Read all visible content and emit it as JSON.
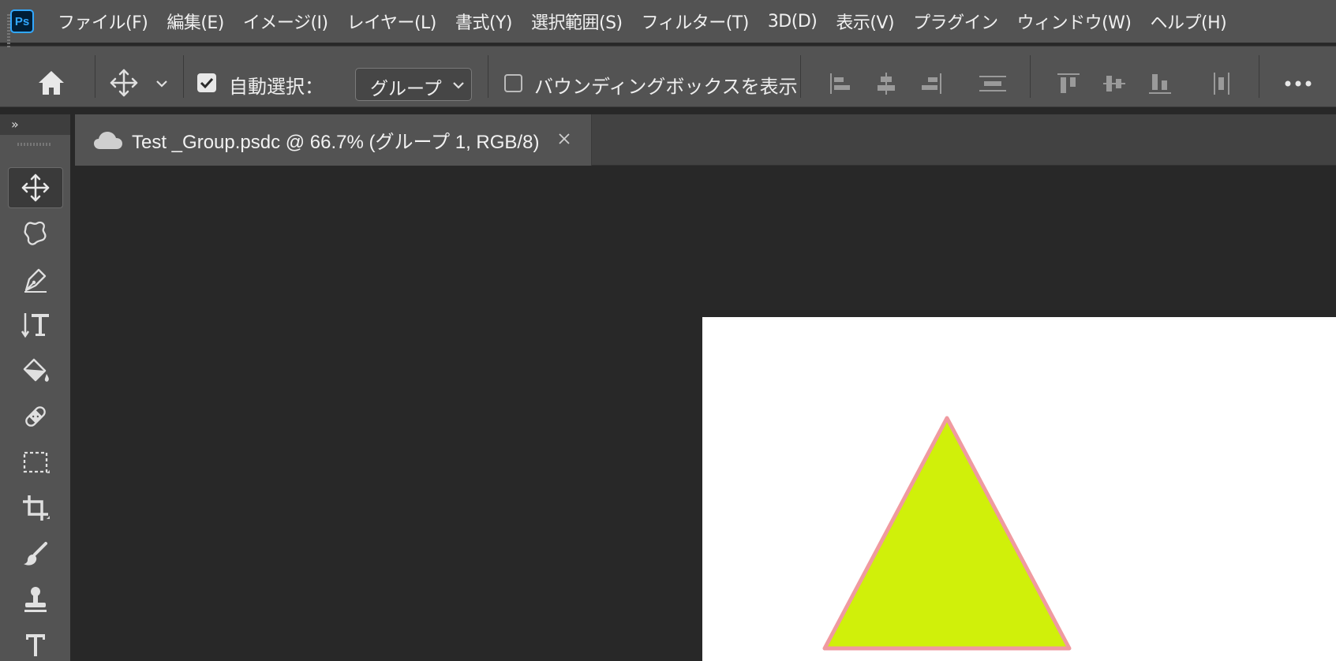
{
  "app": {
    "logo": "Ps",
    "accent": "#31a8ff"
  },
  "menu": [
    "ファイル(F)",
    "編集(E)",
    "イメージ(I)",
    "レイヤー(L)",
    "書式(Y)",
    "選択範囲(S)",
    "フィルター(T)",
    "3D(D)",
    "表示(V)",
    "プラグイン",
    "ウィンドウ(W)",
    "ヘルプ(H)"
  ],
  "options": {
    "auto_select_label": "自動選択：",
    "auto_select_checked": true,
    "auto_select_target": "グループ",
    "bounding_box_label": "バウンディングボックスを表示",
    "bounding_box_checked": false
  },
  "toolbar": {
    "collapse_label": "»",
    "tools": [
      "move-tool-icon",
      "lasso-tool-icon",
      "pen-tool-icon",
      "vertical-type-tool-icon",
      "paint-bucket-icon",
      "healing-brush-icon",
      "marquee-tool-icon",
      "crop-tool-icon",
      "brush-tool-icon",
      "stamp-tool-icon",
      "type-tool-icon"
    ],
    "active_tool": "move-tool-icon"
  },
  "document": {
    "tab_title": "Test _Group.psdc @ 66.7% (グループ 1, RGB/8)",
    "triangle_fill": "#d0f00a",
    "triangle_stroke": "#f09aa0"
  }
}
